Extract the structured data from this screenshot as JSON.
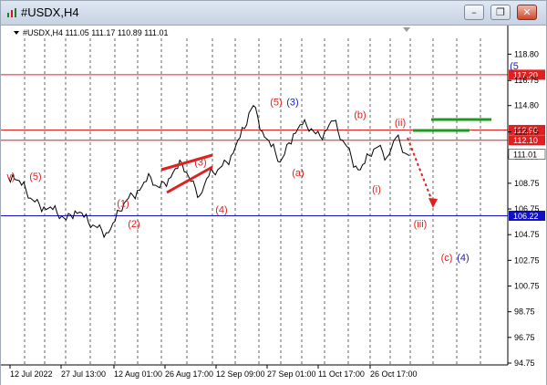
{
  "window": {
    "title": "#USDX,H4",
    "buttons": {
      "minimize": "–",
      "restore": "❐",
      "close": "✕"
    }
  },
  "chart_data": {
    "type": "line",
    "symbol_info": "#USDX,H4  111.05 111.17 110.89 111.01",
    "last_price": 111.01,
    "last_price_label": "111.01",
    "ylim": [
      94.75,
      119.75
    ],
    "y_ticks": [
      "118.80",
      "116.75",
      "114.80",
      "112.75",
      "110.80",
      "108.75",
      "106.75",
      "104.75",
      "102.75",
      "100.75",
      "98.75",
      "96.75",
      "94.75"
    ],
    "x_ticks": [
      "12 Jul 2022",
      "27 Jul 13:00",
      "12 Aug 01:00",
      "26 Aug 17:00",
      "12 Sep 09:00",
      "27 Sep 01:00",
      "11 Oct 17:00",
      "26 Oct 17:00"
    ],
    "levels": [
      {
        "label": "117.20",
        "value": 117.2,
        "color": "#e02020"
      },
      {
        "label": "112.90",
        "value": 112.9,
        "color": "#e02020"
      },
      {
        "label": "112.10",
        "value": 112.1,
        "color": "#e02020"
      },
      {
        "label": "106.22",
        "value": 106.22,
        "color": "#1010c8"
      }
    ],
    "wave_labels_red": [
      {
        "text": "v)",
        "value": 109.3,
        "col": 0
      },
      {
        "text": "(5)",
        "value": 109.3,
        "col": 1
      },
      {
        "text": "(1)",
        "value": 107.2,
        "col": 2
      },
      {
        "text": "(2)",
        "value": 105.6,
        "col": 3
      },
      {
        "text": "(3)",
        "value": 110.4,
        "col": 4
      },
      {
        "text": "(4)",
        "value": 106.7,
        "col": 5
      },
      {
        "text": "(5)",
        "value": 115.1,
        "col": 6
      },
      {
        "text": "(a)",
        "value": 109.6,
        "col": 7
      },
      {
        "text": "(b)",
        "value": 114.1,
        "col": 8
      },
      {
        "text": "(ii)",
        "value": 113.5,
        "col": 9
      },
      {
        "text": "(i)",
        "value": 108.3,
        "col": 10
      },
      {
        "text": "(iii)",
        "value": 105.6,
        "col": 11
      },
      {
        "text": "(c)",
        "value": 103.0,
        "col": 12
      }
    ],
    "wave_labels_blue": [
      {
        "text": "(3)",
        "value": 115.1,
        "col": 0
      },
      {
        "text": "(4)",
        "value": 103.0,
        "col": 1
      },
      {
        "text": "(5",
        "value": 117.9,
        "col": 2
      }
    ],
    "series": [
      {
        "values": [
          109.2,
          109.4,
          109.0,
          108.6,
          108.2,
          107.6,
          107.3,
          107.1,
          106.9,
          106.8,
          106.7,
          106.4,
          106.2,
          105.9,
          106.3,
          106.6,
          106.5,
          106.1,
          105.7,
          105.5,
          105.3,
          105.1,
          104.9,
          105.2,
          105.8,
          106.6,
          107.2,
          107.6,
          107.8,
          108.2,
          108.5,
          108.9,
          109.2,
          108.6,
          108.4,
          108.8,
          109.1,
          109.6,
          109.9,
          110.3,
          109.6,
          108.9,
          108.4,
          107.8,
          108.6,
          109.3,
          109.6,
          109.8,
          110.1,
          110.4,
          110.9,
          111.6,
          112.3,
          113.0,
          114.2,
          114.8,
          113.9,
          112.8,
          112.2,
          111.6,
          111.1,
          110.4,
          111.0,
          111.9,
          112.6,
          113.0,
          113.3,
          113.2,
          113.0,
          112.6,
          112.4,
          112.8,
          113.3,
          113.6,
          112.8,
          112.1,
          111.6,
          110.8,
          110.1,
          109.8,
          110.3,
          110.9,
          111.4,
          111.6,
          111.2,
          110.8,
          111.5,
          112.3,
          111.8,
          111.1,
          110.9
        ]
      }
    ]
  }
}
